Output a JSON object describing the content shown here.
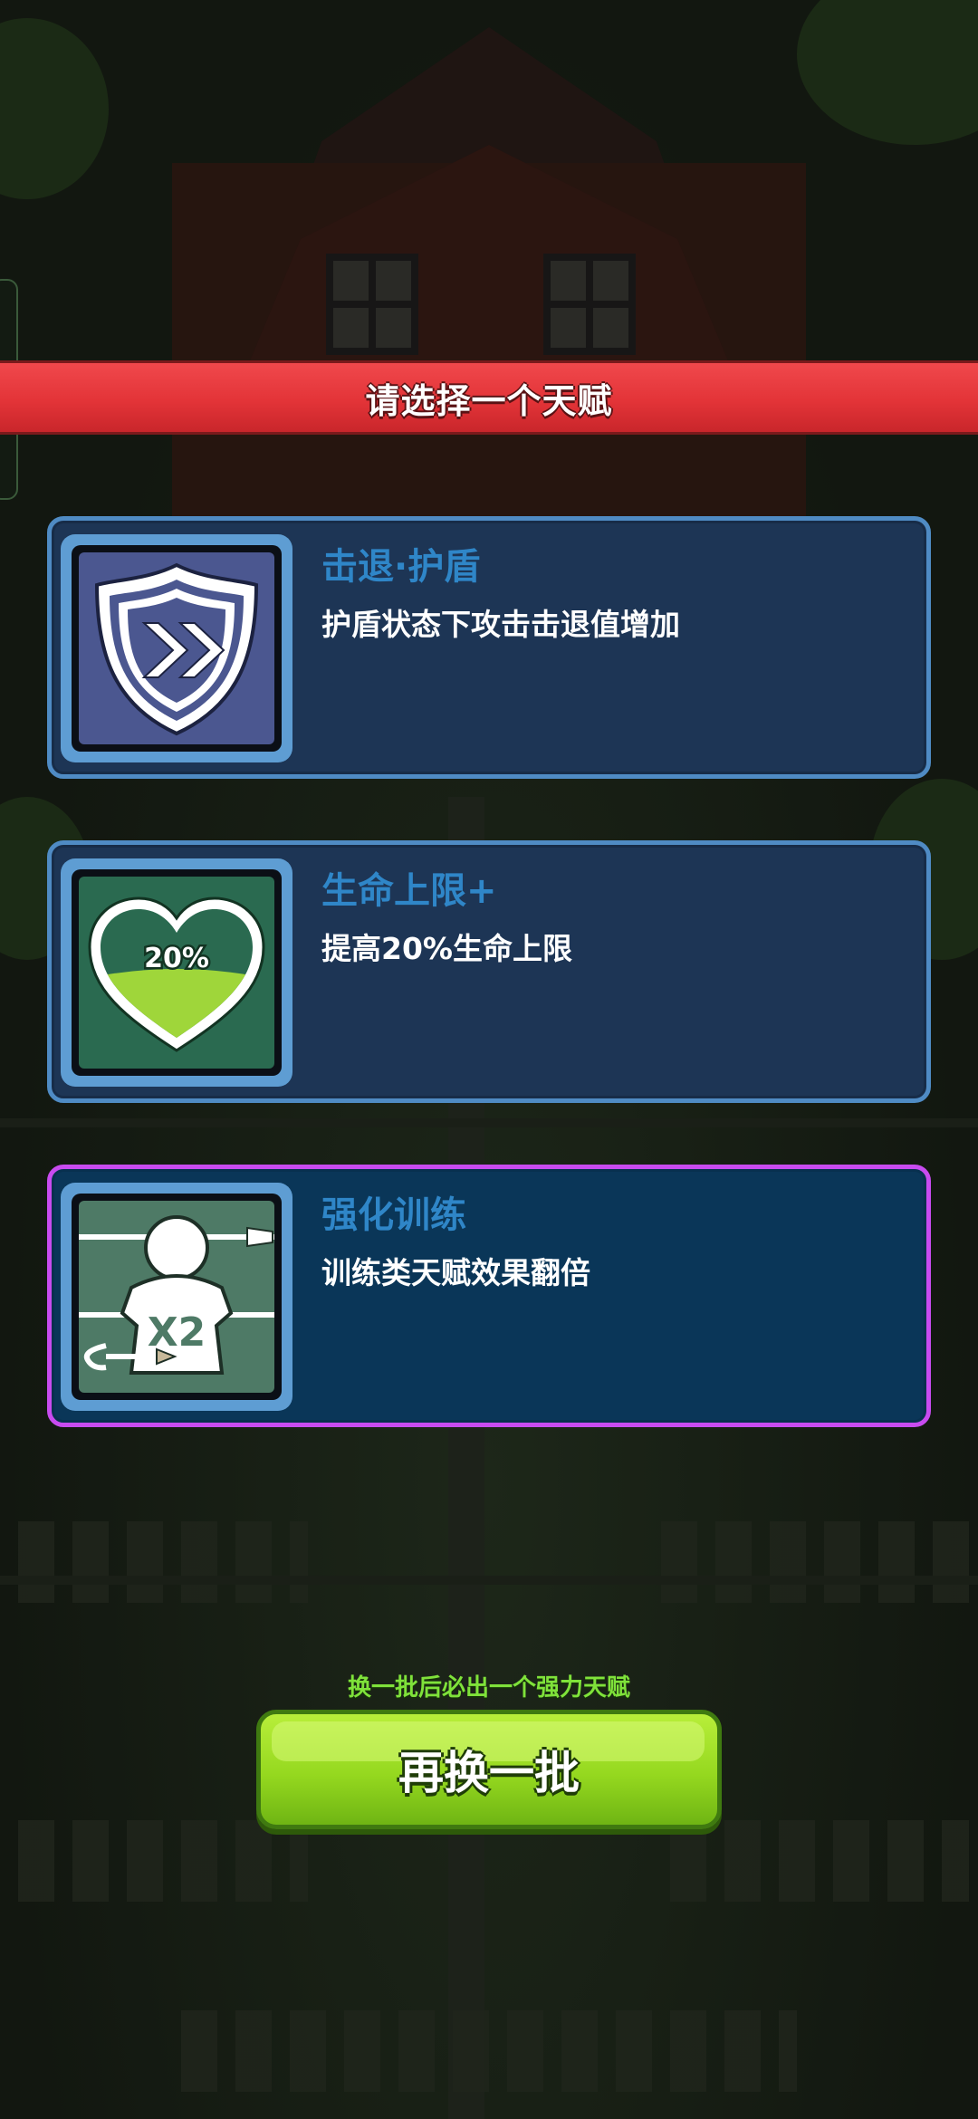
{
  "header": {
    "title": "请选择一个天赋"
  },
  "talents": [
    {
      "title": "击退·护盾",
      "description": "护盾状态下攻击击退值增加",
      "icon": "shield-double-chevron-icon",
      "icon_bg": "#4b5790",
      "selected": false
    },
    {
      "title": "生命上限+",
      "description": "提高20%生命上限",
      "icon": "heart-20-percent-icon",
      "icon_text": "20%",
      "icon_bg": "#2a6a50",
      "selected": false
    },
    {
      "title": "强化训练",
      "description": "训练类天赋效果翻倍",
      "icon": "training-dummy-x2-icon",
      "icon_text": "X2",
      "icon_bg": "#4e7a66",
      "selected": true
    }
  ],
  "footer": {
    "hint": "换一批后必出一个强力天赋",
    "refresh_label": "再换一批"
  },
  "colors": {
    "banner": "#e33438",
    "card_border": "#4f8bc4",
    "selected_border": "#c84bf0",
    "title_text": "#2f86c8",
    "hint_text": "#7fe23a",
    "button": "#95d81f"
  }
}
